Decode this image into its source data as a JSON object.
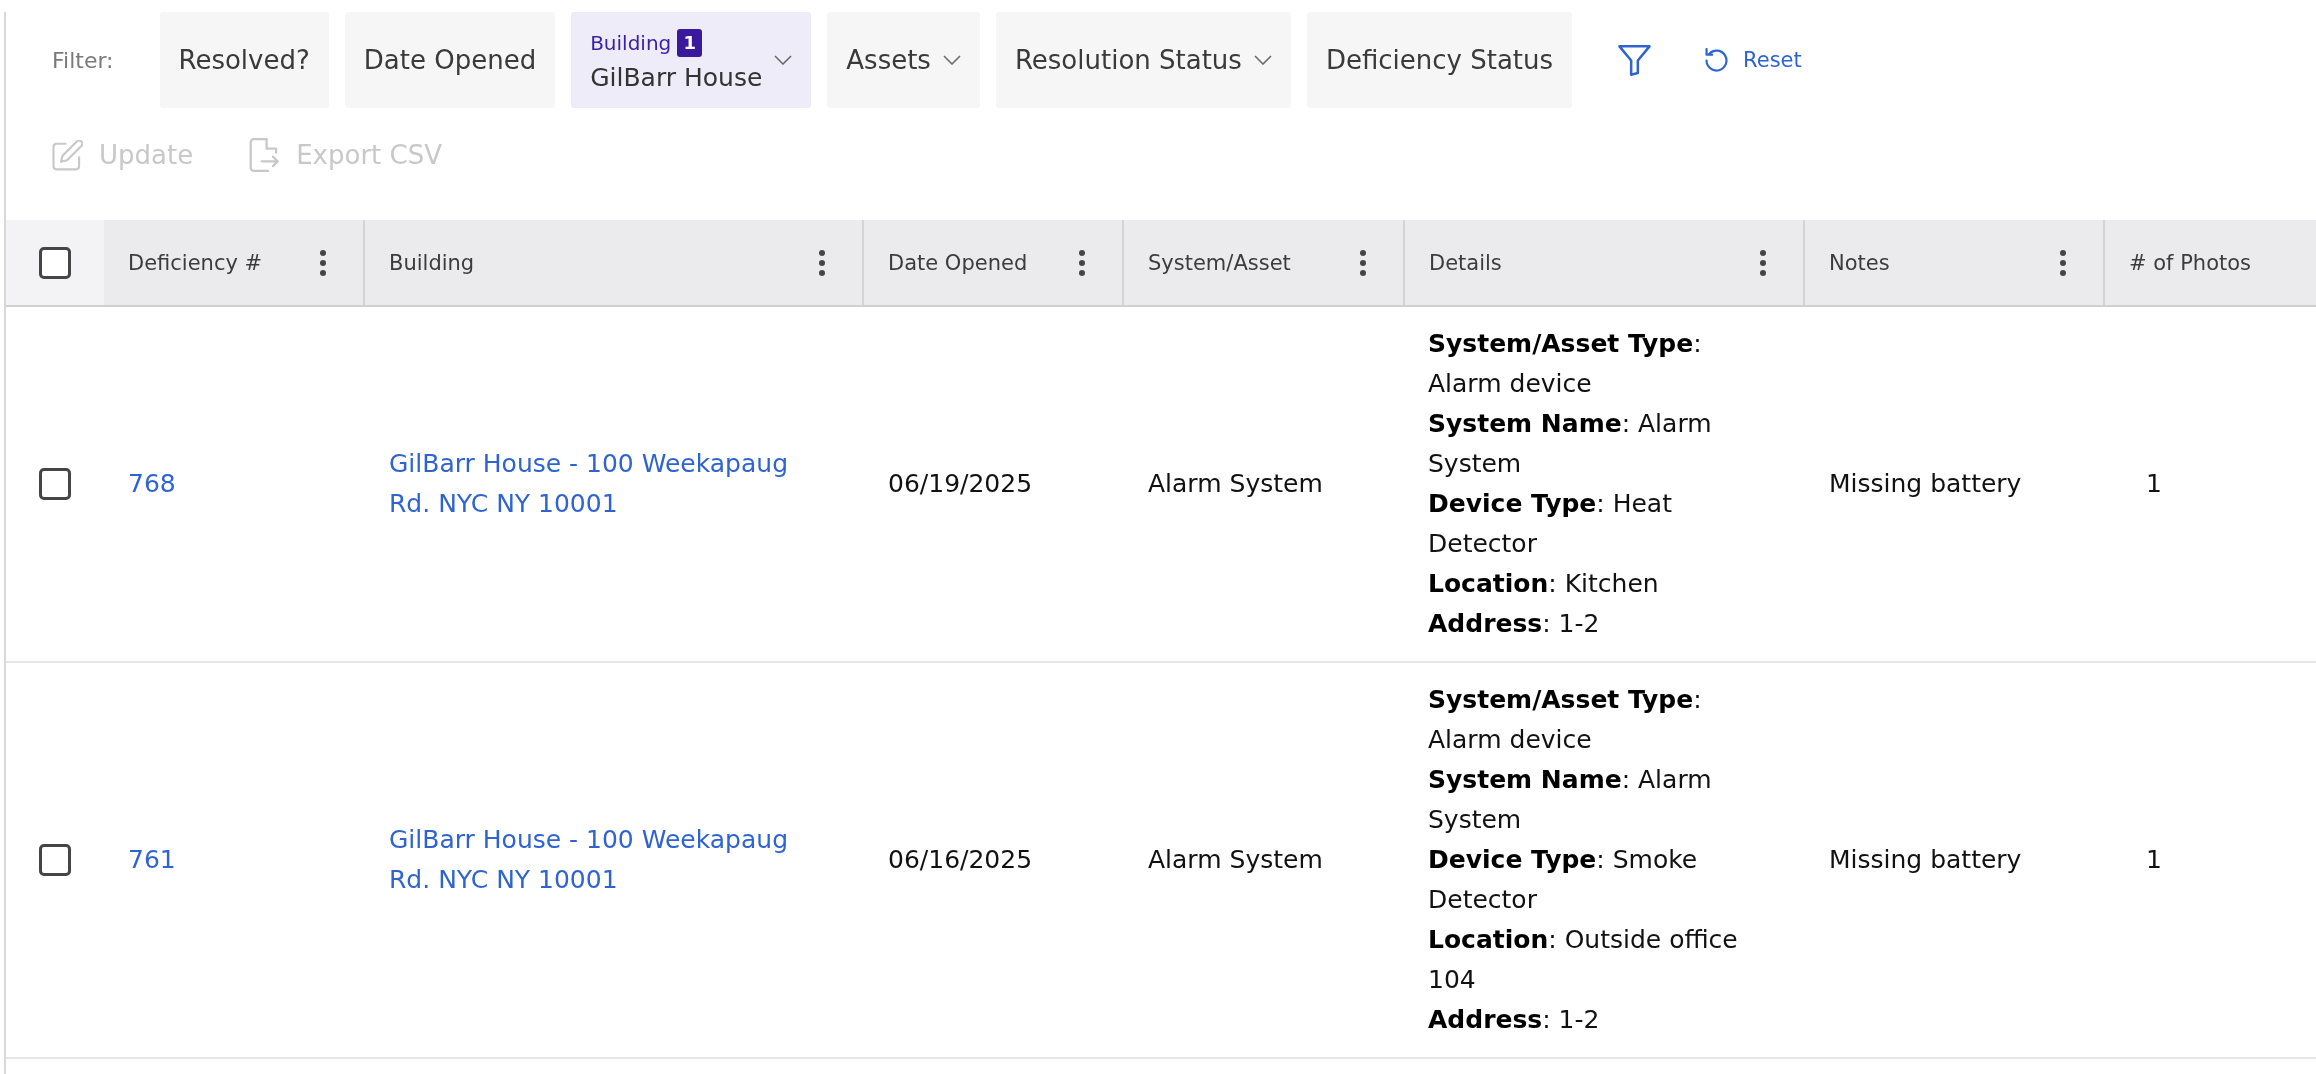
{
  "filter_bar": {
    "label": "Filter:",
    "filters": [
      {
        "label": "Resolved?",
        "dropdown": false,
        "active": false
      },
      {
        "label": "Date Opened",
        "dropdown": false,
        "active": false
      },
      {
        "label": "Building",
        "count": "1",
        "value": "GilBarr House",
        "dropdown": true,
        "active": true
      },
      {
        "label": "Assets",
        "dropdown": true,
        "active": false
      },
      {
        "label": "Resolution Status",
        "dropdown": true,
        "active": false
      },
      {
        "label": "Deficiency Status",
        "dropdown": false,
        "active": false
      }
    ],
    "reset": "Reset"
  },
  "actions": [
    {
      "label": "Update",
      "kind": "edit",
      "disabled": true
    },
    {
      "label": "Export CSV",
      "kind": "export",
      "disabled": true
    }
  ],
  "table": {
    "select_all": {
      "checked": false
    },
    "columns": [
      {
        "label": "Deficiency #",
        "menu": true
      },
      {
        "label": "Building",
        "menu": true
      },
      {
        "label": "Date Opened",
        "menu": true
      },
      {
        "label": "System/Asset",
        "menu": true
      },
      {
        "label": "Details",
        "menu": true
      },
      {
        "label": "Notes",
        "menu": true
      },
      {
        "label": "# of Photos",
        "menu": false
      }
    ],
    "rows": [
      {
        "checked": false,
        "deficiency": "768",
        "building": "GilBarr House - 100 Weekapaug Rd. NYC NY 10001",
        "date_opened": "06/19/2025",
        "system_asset": "Alarm System",
        "details": [
          "**System/Asset Type**: Alarm device",
          "**System Name**: Alarm System",
          "**Device Type**: Heat Detector",
          "**Location**: Kitchen",
          "**Address**: 1-2"
        ],
        "notes": "Missing battery",
        "photos": "1"
      },
      {
        "checked": false,
        "deficiency": "761",
        "building": "GilBarr House - 100 Weekapaug Rd. NYC NY 10001",
        "date_opened": "06/16/2025",
        "system_asset": "Alarm System",
        "details": [
          "**System/Asset Type**: Alarm device",
          "**System Name**: Alarm System",
          "**Device Type**: Smoke Detector",
          "**Location**: Outside office 104",
          "**Address**: 1-2"
        ],
        "notes": "Missing battery",
        "photos": "1"
      }
    ]
  }
}
